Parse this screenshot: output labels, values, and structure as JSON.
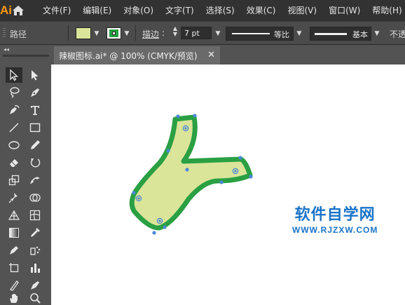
{
  "app": {
    "logo": "Ai",
    "menu": [
      "文件(F)",
      "编辑(E)",
      "对象(O)",
      "文字(T)",
      "选择(S)",
      "效果(C)",
      "视图(V)",
      "窗口(W)",
      "帮助(H)"
    ]
  },
  "control_bar": {
    "selection_label": "路径",
    "fill_color": "#dbe59a",
    "stroke_color": "#22a03e",
    "stroke_label": "描边",
    "stroke_weight": "7 pt",
    "variable_width_profile": "等比",
    "brush_definition": "基本",
    "opacity_label": "不透"
  },
  "document": {
    "tab_title": "辣椒图标.ai* @ 100% (CMYK/预览)",
    "close_symbol": "✕"
  },
  "watermark": {
    "title": "软件自学网",
    "url": "WWW.RJZXW.COM",
    "color": "#1a73c8"
  },
  "tools": [
    "selection-tool",
    "direct-selection-tool",
    "lasso-tool",
    "pen-tool",
    "curvature-tool",
    "type-tool",
    "line-segment-tool",
    "rectangle-tool",
    "ellipse-tool",
    "pencil-tool",
    "eraser-tool",
    "rotate-tool",
    "scale-tool",
    "puppet-warp-tool",
    "pin-tool",
    "shape-builder-tool",
    "perspective-grid-tool",
    "mesh-tool",
    "gradient-tool",
    "eyedropper-tool",
    "blend-tool",
    "symbol-sprayer-tool",
    "column-graph-tool",
    "artboard-tool",
    "slice-tool",
    "hand-tool",
    "zoom-tool"
  ]
}
